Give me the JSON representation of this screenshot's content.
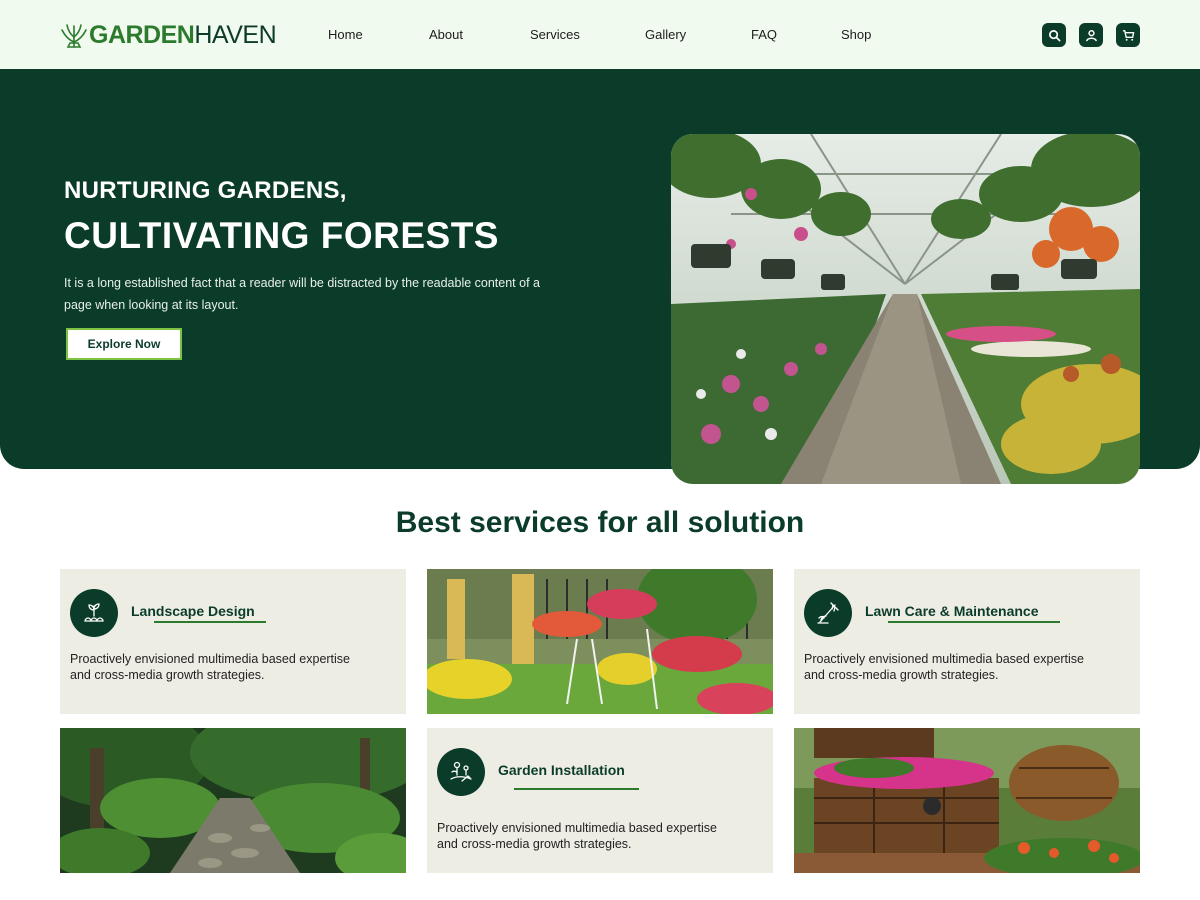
{
  "header": {
    "logo": {
      "strong": "GARDEN",
      "light": "HAVEN",
      "icon": "fern-icon"
    },
    "nav": [
      {
        "label": "Home"
      },
      {
        "label": "About"
      },
      {
        "label": "Services"
      },
      {
        "label": "Gallery"
      },
      {
        "label": "FAQ"
      },
      {
        "label": "Shop"
      }
    ],
    "actions": [
      {
        "icon": "search-icon"
      },
      {
        "icon": "user-icon"
      },
      {
        "icon": "cart-icon"
      }
    ]
  },
  "hero": {
    "eyebrow": "NURTURING GARDENS,",
    "title": "CULTIVATING FORESTS",
    "description": "It is a long established fact that a reader will be distracted by the readable content of a page when looking at its layout.",
    "button_label": "Explore Now",
    "image": "greenhouse-photo"
  },
  "services": {
    "title": "Best services for all solution",
    "cards": [
      {
        "title": "Landscape Design",
        "description": "Proactively envisioned multimedia based expertise and cross-media growth strategies.",
        "icon": "seedling-icon"
      },
      {
        "title": "Lawn Care & Maintenance",
        "description": "Proactively envisioned multimedia based expertise and cross-media growth strategies.",
        "icon": "rake-icon"
      },
      {
        "title": "Garden Installation",
        "description": "Proactively envisioned multimedia based expertise and cross-media growth strategies.",
        "icon": "flower-planting-icon"
      }
    ],
    "photos": [
      "flower-planters-photo",
      "forest-path-photo",
      "treasure-chest-planter-photo"
    ]
  },
  "colors": {
    "primary": "#0b3c29",
    "accent": "#2c7a2d",
    "lime": "#7dc242",
    "header_bg": "#f1faef",
    "card_bg": "#eeede4"
  }
}
